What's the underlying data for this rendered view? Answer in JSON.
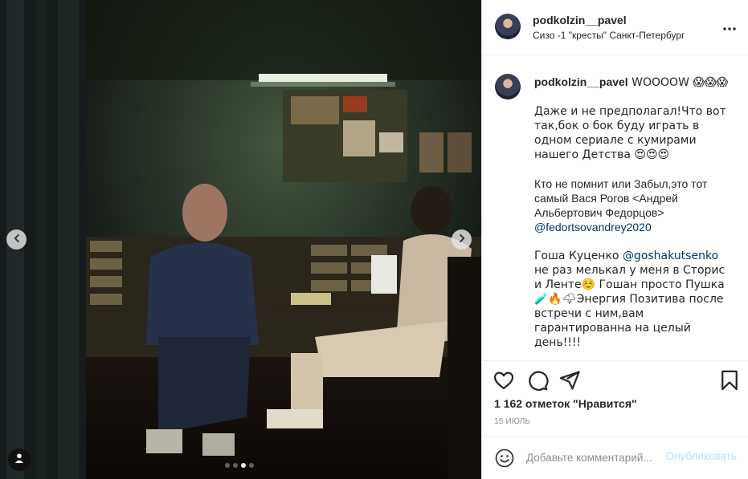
{
  "post": {
    "username": "podkolzin__pavel",
    "location": "Сизо -1 \"кресты\" Санкт-Петербург"
  },
  "caption": {
    "username": "podkolzin__pavel",
    "first_line": " WOOOOW 😱😱😱",
    "para1": "Даже и не предполагал!Что вот так,бок о бок буду играть в одном сериале с кумирами нашего Детства 😍😍😍",
    "para2": "Кто не помнит или Забыл,это тот самый Вася Рогов <Андрей Альбертович Федорцов>",
    "mention1": "@fedortsovandrey2020",
    "para3_start": "Гоша Куценко ",
    "mention2": "@goshakutsenko",
    "para3_end": " не раз мелькал у меня в Сторис и Ленте☺️ Гошан просто Пушка 🧪🔥🌩Энергия Позитива после встречи с ним,вам гарантированна на целый день!!!!"
  },
  "stats": {
    "likes": "1 162 отметок \"Нравится\"",
    "date": "15 ИЮЛЬ"
  },
  "comment_box": {
    "placeholder": "Добавьте комментарий...",
    "post_label": "Опубликовать"
  },
  "carousel": {
    "total_slides": 4,
    "active_slide": 3
  },
  "colors": {
    "text": "#262626",
    "secondary": "#8e8e8e",
    "mention": "#00376b",
    "post_disabled": "#b2dffc",
    "border": "#efefef"
  },
  "icons": [
    "chevron-left-icon",
    "chevron-right-icon",
    "user-tag-icon",
    "more-options-icon",
    "heart-icon",
    "comment-icon",
    "share-icon",
    "bookmark-icon",
    "emoji-icon"
  ]
}
